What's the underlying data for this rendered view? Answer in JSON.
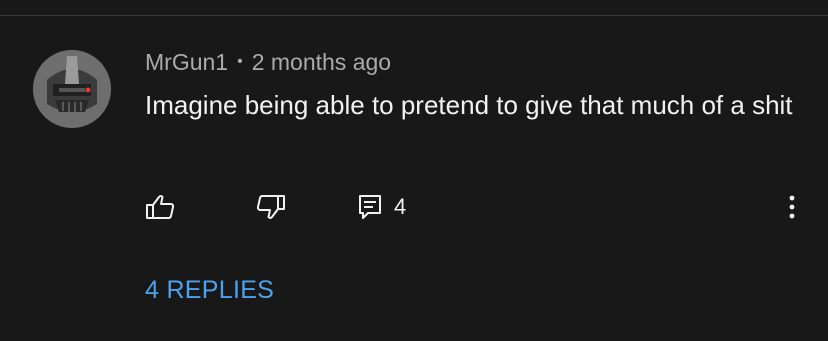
{
  "comment": {
    "author": "MrGun1",
    "separator": "•",
    "timestamp": "2 months ago",
    "text": "Imagine being able to pretend to give that much of a shit",
    "avatar_icon": "cylon-helmet-avatar"
  },
  "actions": {
    "like_icon": "thumbs-up-icon",
    "dislike_icon": "thumbs-down-icon",
    "reply_icon": "comment-icon",
    "reply_count": "4",
    "more_icon": "more-vert-icon"
  },
  "replies": {
    "label": "4 REPLIES",
    "color": "#4ca2ee"
  }
}
